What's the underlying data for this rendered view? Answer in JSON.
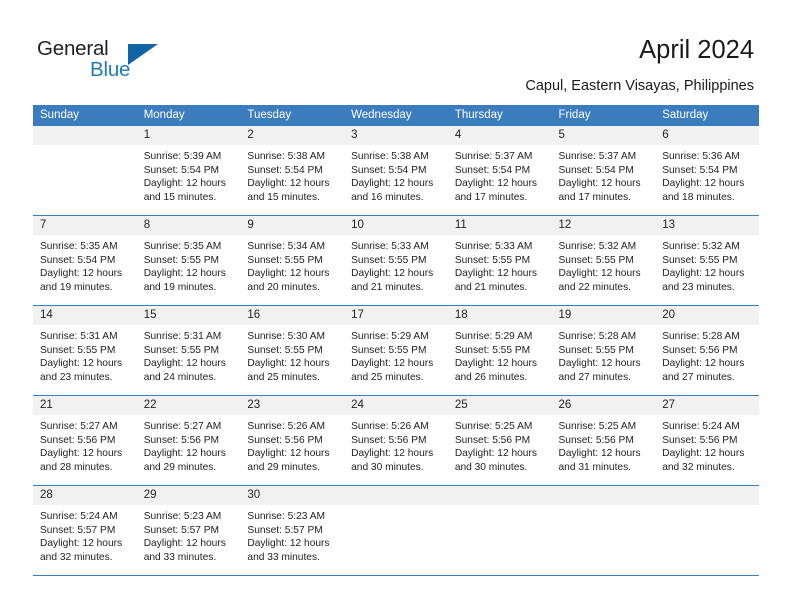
{
  "brand": {
    "name_part1": "General",
    "name_part2": "Blue"
  },
  "header": {
    "title": "April 2024",
    "subtitle": "Capul, Eastern Visayas, Philippines"
  },
  "colors": {
    "header_blue": "#3a7cbe",
    "logo_blue": "#1f7ac0",
    "daynum_band": "#f1f1f1"
  },
  "weekdays": [
    "Sunday",
    "Monday",
    "Tuesday",
    "Wednesday",
    "Thursday",
    "Friday",
    "Saturday"
  ],
  "weeks": [
    [
      {
        "day": "",
        "empty": true,
        "sunrise": "",
        "sunset": "",
        "daylight1": "",
        "daylight2": ""
      },
      {
        "day": "1",
        "sunrise": "Sunrise: 5:39 AM",
        "sunset": "Sunset: 5:54 PM",
        "daylight1": "Daylight: 12 hours",
        "daylight2": "and 15 minutes."
      },
      {
        "day": "2",
        "sunrise": "Sunrise: 5:38 AM",
        "sunset": "Sunset: 5:54 PM",
        "daylight1": "Daylight: 12 hours",
        "daylight2": "and 15 minutes."
      },
      {
        "day": "3",
        "sunrise": "Sunrise: 5:38 AM",
        "sunset": "Sunset: 5:54 PM",
        "daylight1": "Daylight: 12 hours",
        "daylight2": "and 16 minutes."
      },
      {
        "day": "4",
        "sunrise": "Sunrise: 5:37 AM",
        "sunset": "Sunset: 5:54 PM",
        "daylight1": "Daylight: 12 hours",
        "daylight2": "and 17 minutes."
      },
      {
        "day": "5",
        "sunrise": "Sunrise: 5:37 AM",
        "sunset": "Sunset: 5:54 PM",
        "daylight1": "Daylight: 12 hours",
        "daylight2": "and 17 minutes."
      },
      {
        "day": "6",
        "sunrise": "Sunrise: 5:36 AM",
        "sunset": "Sunset: 5:54 PM",
        "daylight1": "Daylight: 12 hours",
        "daylight2": "and 18 minutes."
      }
    ],
    [
      {
        "day": "7",
        "sunrise": "Sunrise: 5:35 AM",
        "sunset": "Sunset: 5:54 PM",
        "daylight1": "Daylight: 12 hours",
        "daylight2": "and 19 minutes."
      },
      {
        "day": "8",
        "sunrise": "Sunrise: 5:35 AM",
        "sunset": "Sunset: 5:55 PM",
        "daylight1": "Daylight: 12 hours",
        "daylight2": "and 19 minutes."
      },
      {
        "day": "9",
        "sunrise": "Sunrise: 5:34 AM",
        "sunset": "Sunset: 5:55 PM",
        "daylight1": "Daylight: 12 hours",
        "daylight2": "and 20 minutes."
      },
      {
        "day": "10",
        "sunrise": "Sunrise: 5:33 AM",
        "sunset": "Sunset: 5:55 PM",
        "daylight1": "Daylight: 12 hours",
        "daylight2": "and 21 minutes."
      },
      {
        "day": "11",
        "sunrise": "Sunrise: 5:33 AM",
        "sunset": "Sunset: 5:55 PM",
        "daylight1": "Daylight: 12 hours",
        "daylight2": "and 21 minutes."
      },
      {
        "day": "12",
        "sunrise": "Sunrise: 5:32 AM",
        "sunset": "Sunset: 5:55 PM",
        "daylight1": "Daylight: 12 hours",
        "daylight2": "and 22 minutes."
      },
      {
        "day": "13",
        "sunrise": "Sunrise: 5:32 AM",
        "sunset": "Sunset: 5:55 PM",
        "daylight1": "Daylight: 12 hours",
        "daylight2": "and 23 minutes."
      }
    ],
    [
      {
        "day": "14",
        "sunrise": "Sunrise: 5:31 AM",
        "sunset": "Sunset: 5:55 PM",
        "daylight1": "Daylight: 12 hours",
        "daylight2": "and 23 minutes."
      },
      {
        "day": "15",
        "sunrise": "Sunrise: 5:31 AM",
        "sunset": "Sunset: 5:55 PM",
        "daylight1": "Daylight: 12 hours",
        "daylight2": "and 24 minutes."
      },
      {
        "day": "16",
        "sunrise": "Sunrise: 5:30 AM",
        "sunset": "Sunset: 5:55 PM",
        "daylight1": "Daylight: 12 hours",
        "daylight2": "and 25 minutes."
      },
      {
        "day": "17",
        "sunrise": "Sunrise: 5:29 AM",
        "sunset": "Sunset: 5:55 PM",
        "daylight1": "Daylight: 12 hours",
        "daylight2": "and 25 minutes."
      },
      {
        "day": "18",
        "sunrise": "Sunrise: 5:29 AM",
        "sunset": "Sunset: 5:55 PM",
        "daylight1": "Daylight: 12 hours",
        "daylight2": "and 26 minutes."
      },
      {
        "day": "19",
        "sunrise": "Sunrise: 5:28 AM",
        "sunset": "Sunset: 5:55 PM",
        "daylight1": "Daylight: 12 hours",
        "daylight2": "and 27 minutes."
      },
      {
        "day": "20",
        "sunrise": "Sunrise: 5:28 AM",
        "sunset": "Sunset: 5:56 PM",
        "daylight1": "Daylight: 12 hours",
        "daylight2": "and 27 minutes."
      }
    ],
    [
      {
        "day": "21",
        "sunrise": "Sunrise: 5:27 AM",
        "sunset": "Sunset: 5:56 PM",
        "daylight1": "Daylight: 12 hours",
        "daylight2": "and 28 minutes."
      },
      {
        "day": "22",
        "sunrise": "Sunrise: 5:27 AM",
        "sunset": "Sunset: 5:56 PM",
        "daylight1": "Daylight: 12 hours",
        "daylight2": "and 29 minutes."
      },
      {
        "day": "23",
        "sunrise": "Sunrise: 5:26 AM",
        "sunset": "Sunset: 5:56 PM",
        "daylight1": "Daylight: 12 hours",
        "daylight2": "and 29 minutes."
      },
      {
        "day": "24",
        "sunrise": "Sunrise: 5:26 AM",
        "sunset": "Sunset: 5:56 PM",
        "daylight1": "Daylight: 12 hours",
        "daylight2": "and 30 minutes."
      },
      {
        "day": "25",
        "sunrise": "Sunrise: 5:25 AM",
        "sunset": "Sunset: 5:56 PM",
        "daylight1": "Daylight: 12 hours",
        "daylight2": "and 30 minutes."
      },
      {
        "day": "26",
        "sunrise": "Sunrise: 5:25 AM",
        "sunset": "Sunset: 5:56 PM",
        "daylight1": "Daylight: 12 hours",
        "daylight2": "and 31 minutes."
      },
      {
        "day": "27",
        "sunrise": "Sunrise: 5:24 AM",
        "sunset": "Sunset: 5:56 PM",
        "daylight1": "Daylight: 12 hours",
        "daylight2": "and 32 minutes."
      }
    ],
    [
      {
        "day": "28",
        "sunrise": "Sunrise: 5:24 AM",
        "sunset": "Sunset: 5:57 PM",
        "daylight1": "Daylight: 12 hours",
        "daylight2": "and 32 minutes."
      },
      {
        "day": "29",
        "sunrise": "Sunrise: 5:23 AM",
        "sunset": "Sunset: 5:57 PM",
        "daylight1": "Daylight: 12 hours",
        "daylight2": "and 33 minutes."
      },
      {
        "day": "30",
        "sunrise": "Sunrise: 5:23 AM",
        "sunset": "Sunset: 5:57 PM",
        "daylight1": "Daylight: 12 hours",
        "daylight2": "and 33 minutes."
      },
      {
        "day": "",
        "empty": true,
        "sunrise": "",
        "sunset": "",
        "daylight1": "",
        "daylight2": ""
      },
      {
        "day": "",
        "empty": true,
        "sunrise": "",
        "sunset": "",
        "daylight1": "",
        "daylight2": ""
      },
      {
        "day": "",
        "empty": true,
        "sunrise": "",
        "sunset": "",
        "daylight1": "",
        "daylight2": ""
      },
      {
        "day": "",
        "empty": true,
        "sunrise": "",
        "sunset": "",
        "daylight1": "",
        "daylight2": ""
      }
    ]
  ]
}
